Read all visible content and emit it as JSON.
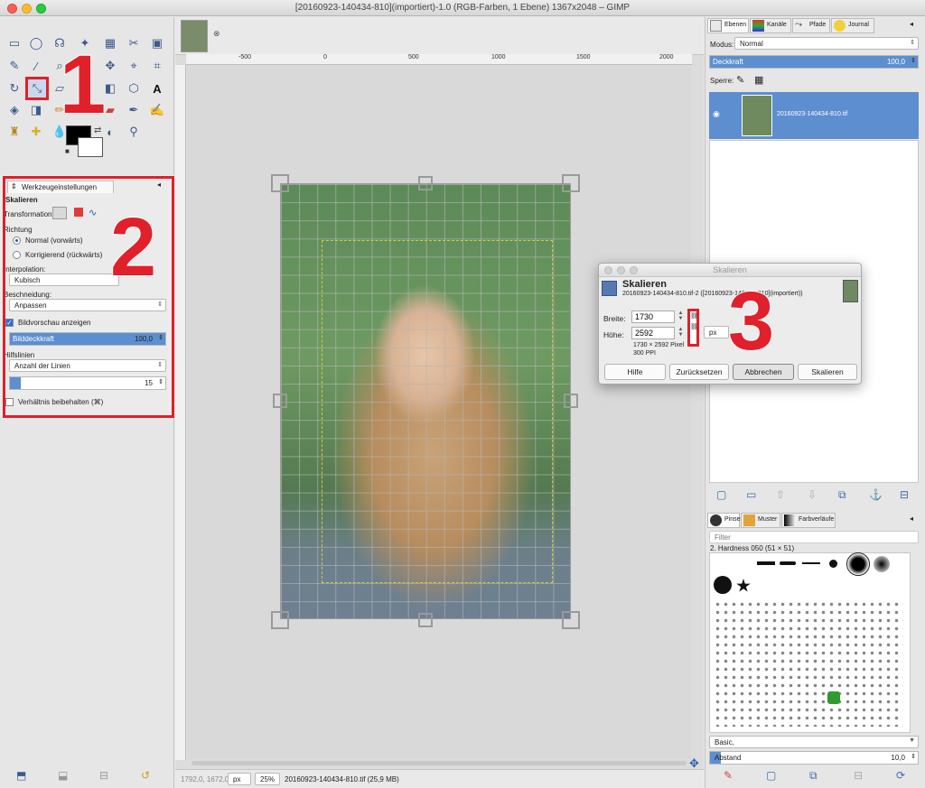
{
  "window": {
    "title": "[20160923-140434-810](importiert)-1.0 (RGB-Farben, 1 Ebene) 1367x2048 – GIMP"
  },
  "annotations": [
    "1",
    "2",
    "3"
  ],
  "tool_options": {
    "tab_label": "Werkzeugeinstellungen",
    "tool_name": "Skalieren",
    "transform_label": "Transformation:",
    "direction_label": "Richtung",
    "direction_normal": "Normal (vorwärts)",
    "direction_corrective": "Korrigierend (rückwärts)",
    "interpolation_label": "Interpolation:",
    "interpolation_value": "Kubisch",
    "clipping_label": "Beschneidung:",
    "clipping_value": "Anpassen",
    "preview_label": "Bildvorschau anzeigen",
    "opacity_label": "Bilddeckkraft",
    "opacity_value": "100,0",
    "opacity_fraction": 1.0,
    "guides_label": "Hilfslinien",
    "guides_value": "Anzahl der Linien",
    "lines_value": "15",
    "lines_fraction": 0.07,
    "keep_ratio_label": "Verhältnis beibehalten (⌘)"
  },
  "ruler": {
    "ticks": [
      "-500",
      "0",
      "500",
      "1000",
      "1500",
      "2000"
    ]
  },
  "status": {
    "coords": "1792,0, 1672,0",
    "unit": "px",
    "zoom": "25%",
    "file_info": "20160923-140434-810.tif (25,9 MB)"
  },
  "layers": {
    "tabs": [
      "Ebenen",
      "Kanäle",
      "Pfade",
      "Journal"
    ],
    "mode_label": "Modus:",
    "mode_value": "Normal",
    "opacity_label": "Deckkraft",
    "opacity_value": "100,0",
    "lock_label": "Sperre:",
    "layer_name": "20160923-140434-810.tif"
  },
  "brushes": {
    "tabs": [
      "Pinsel",
      "Muster",
      "Farbverläufe"
    ],
    "filter_placeholder": "Filter",
    "brush_name": "2. Hardness 050 (51 × 51)",
    "tag_value": "Basic,",
    "spacing_label": "Abstand",
    "spacing_value": "10,0"
  },
  "scale_dialog": {
    "title": "Skalieren",
    "heading": "Skalieren",
    "subtitle": "20160923-140434-810.tif-2 ([20160923-140434-810](importiert))",
    "width_label": "Breite:",
    "width_value": "1730",
    "height_label": "Höhe:",
    "height_value": "2592",
    "unit": "px",
    "size_info": "1730 × 2592 Pixel",
    "ppi_info": "300 PPI",
    "buttons": [
      "Hilfe",
      "Zurücksetzen",
      "Abbrechen",
      "Skalieren"
    ]
  }
}
